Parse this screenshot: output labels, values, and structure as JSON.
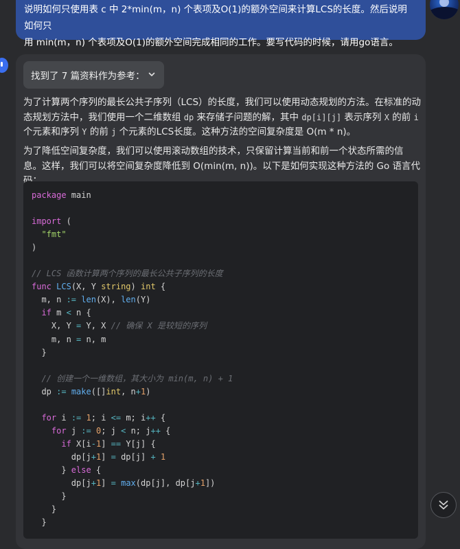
{
  "user_message": {
    "line1": "说明如何只使用表 c 中 2*min(m，n) 个表项及O(1)的额外空间来计算LCS的长度。然后说明如何只",
    "line2": "用 min(m，n) 个表项及O(1)的额外空间完成相同的工作。要写代码的时候，请用go语言。"
  },
  "answer": {
    "refs_label": "找到了 7 篇资料作为参考：",
    "para1": [
      {
        "text": "为了计算两个序列的最长公共子序列（LCS）的长度，我们可以使用动态规划的方法。在标准的动态"
      },
      {
        "text": "规划方法中，我们使用一个二维数组 "
      },
      {
        "code": "dp"
      },
      {
        "text": " 来存储子问题的解，其中 "
      },
      {
        "code": "dp[i][j]"
      },
      {
        "text": " 表示序列 "
      },
      {
        "code": "X"
      },
      {
        "text": " 的前 "
      },
      {
        "code": "i"
      },
      {
        "text": " 个元素和序列 "
      },
      {
        "code": "Y"
      },
      {
        "text": " 的前 "
      },
      {
        "code": "j"
      },
      {
        "text": " 个元素的LCS长度。这种方法的空间复杂度是 O(m * n)。"
      }
    ],
    "para2": "为了降低空间复杂度，我们可以使用滚动数组的技术，只保留计算当前和前一个状态所需的信息。这样，我们可以将空间复杂度降低到 O(min(m, n))。以下是如何实现这种方法的 Go 语言代码：",
    "code_lines": [
      [
        [
          "k",
          "package"
        ],
        [
          "p",
          " main"
        ]
      ],
      [],
      [
        [
          "k",
          "import"
        ],
        [
          "p",
          " ("
        ]
      ],
      [
        [
          "p",
          "  "
        ],
        [
          "s",
          "\"fmt\""
        ]
      ],
      [
        [
          "p",
          ")"
        ]
      ],
      [],
      [
        [
          "c",
          "// LCS 函数计算两个序列的最长公共子序列的长度"
        ]
      ],
      [
        [
          "k",
          "func"
        ],
        [
          "p",
          " "
        ],
        [
          "f",
          "LCS"
        ],
        [
          "p",
          "(X, Y "
        ],
        [
          "t",
          "string"
        ],
        [
          "p",
          ") "
        ],
        [
          "t",
          "int"
        ],
        [
          "p",
          " {"
        ]
      ],
      [
        [
          "p",
          "  m, n "
        ],
        [
          "o",
          ":="
        ],
        [
          "p",
          " "
        ],
        [
          "f",
          "len"
        ],
        [
          "p",
          "(X), "
        ],
        [
          "f",
          "len"
        ],
        [
          "p",
          "(Y)"
        ]
      ],
      [
        [
          "p",
          "  "
        ],
        [
          "k",
          "if"
        ],
        [
          "p",
          " m "
        ],
        [
          "o",
          "<"
        ],
        [
          "p",
          " n {"
        ]
      ],
      [
        [
          "p",
          "    X, Y "
        ],
        [
          "o",
          "="
        ],
        [
          "p",
          " Y, X "
        ],
        [
          "c",
          "// 确保 X 是较短的序列"
        ]
      ],
      [
        [
          "p",
          "    m, n "
        ],
        [
          "o",
          "="
        ],
        [
          "p",
          " n, m"
        ]
      ],
      [
        [
          "p",
          "  }"
        ]
      ],
      [],
      [
        [
          "p",
          "  "
        ],
        [
          "c",
          "// 创建一个一维数组，其大小为 min(m, n) + 1"
        ]
      ],
      [
        [
          "p",
          "  dp "
        ],
        [
          "o",
          ":="
        ],
        [
          "p",
          " "
        ],
        [
          "f",
          "make"
        ],
        [
          "p",
          "([]"
        ],
        [
          "t",
          "int"
        ],
        [
          "p",
          ", n"
        ],
        [
          "o",
          "+"
        ],
        [
          "n",
          "1"
        ],
        [
          "p",
          ")"
        ]
      ],
      [],
      [
        [
          "p",
          "  "
        ],
        [
          "k",
          "for"
        ],
        [
          "p",
          " i "
        ],
        [
          "o",
          ":="
        ],
        [
          "p",
          " "
        ],
        [
          "n",
          "1"
        ],
        [
          "p",
          "; i "
        ],
        [
          "o",
          "<="
        ],
        [
          "p",
          " m; i"
        ],
        [
          "o",
          "++"
        ],
        [
          "p",
          " {"
        ]
      ],
      [
        [
          "p",
          "    "
        ],
        [
          "k",
          "for"
        ],
        [
          "p",
          " j "
        ],
        [
          "o",
          ":="
        ],
        [
          "p",
          " "
        ],
        [
          "n",
          "0"
        ],
        [
          "p",
          "; j "
        ],
        [
          "o",
          "<"
        ],
        [
          "p",
          " n; j"
        ],
        [
          "o",
          "++"
        ],
        [
          "p",
          " {"
        ]
      ],
      [
        [
          "p",
          "      "
        ],
        [
          "k",
          "if"
        ],
        [
          "p",
          " X[i"
        ],
        [
          "o",
          "-"
        ],
        [
          "n",
          "1"
        ],
        [
          "p",
          "] "
        ],
        [
          "o",
          "=="
        ],
        [
          "p",
          " Y[j] {"
        ]
      ],
      [
        [
          "p",
          "        dp[j"
        ],
        [
          "o",
          "+"
        ],
        [
          "n",
          "1"
        ],
        [
          "p",
          "] "
        ],
        [
          "o",
          "="
        ],
        [
          "p",
          " dp[j] "
        ],
        [
          "o",
          "+"
        ],
        [
          "p",
          " "
        ],
        [
          "n",
          "1"
        ]
      ],
      [
        [
          "p",
          "      } "
        ],
        [
          "k",
          "else"
        ],
        [
          "p",
          " {"
        ]
      ],
      [
        [
          "p",
          "        dp[j"
        ],
        [
          "o",
          "+"
        ],
        [
          "n",
          "1"
        ],
        [
          "p",
          "] "
        ],
        [
          "o",
          "="
        ],
        [
          "p",
          " "
        ],
        [
          "f",
          "max"
        ],
        [
          "p",
          "(dp[j], dp[j"
        ],
        [
          "o",
          "+"
        ],
        [
          "n",
          "1"
        ],
        [
          "p",
          "])"
        ]
      ],
      [
        [
          "p",
          "      }"
        ]
      ],
      [
        [
          "p",
          "    }"
        ]
      ],
      [
        [
          "p",
          "  }"
        ]
      ]
    ]
  },
  "colors": {
    "user_bubble": "#2f4f9a",
    "card": "#333438",
    "code_bg": "#202124",
    "keyword": "#d86bd8",
    "string": "#a5d86a",
    "function": "#61aeee",
    "type": "#e2c86a",
    "comment": "#6b6e74",
    "number": "#e5a36b"
  },
  "icons": {
    "refs_chevron": "chevron-down-icon",
    "scroll_button": "double-chevron-down-icon",
    "assistant": "assistant-avatar-icon",
    "user": "user-avatar"
  }
}
